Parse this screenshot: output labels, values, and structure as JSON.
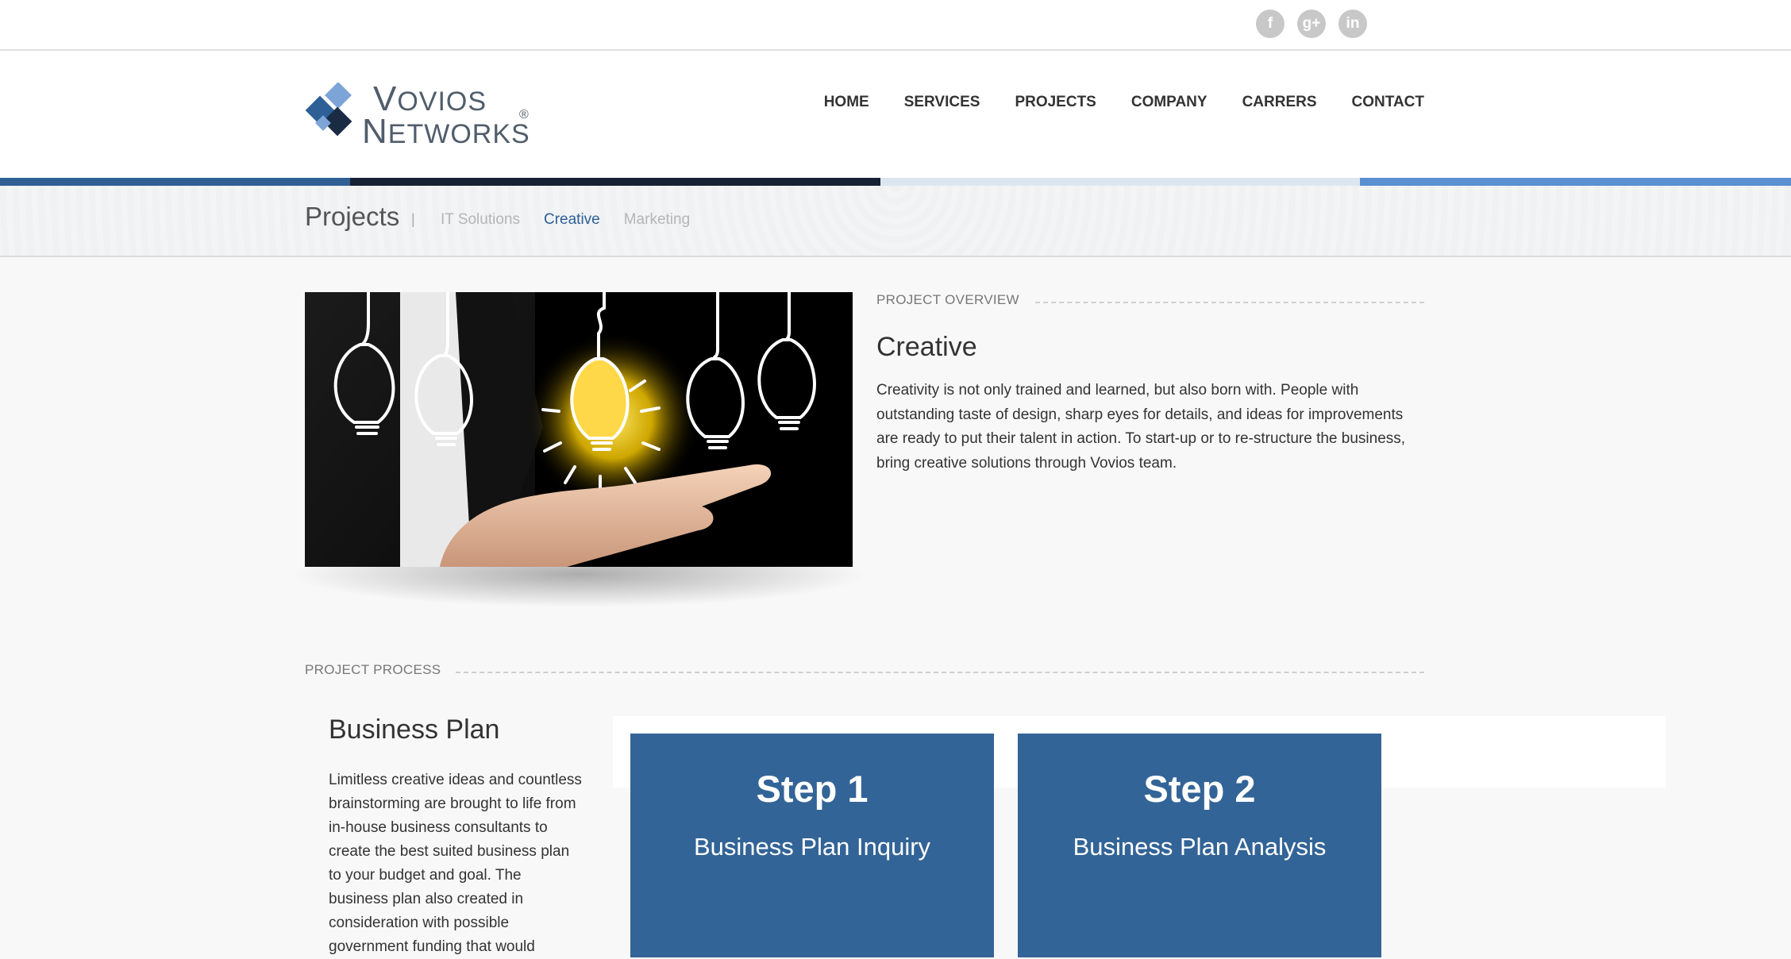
{
  "social": {
    "facebook": "f",
    "googleplus": "g+",
    "linkedin": "in"
  },
  "logo": {
    "line1_initial": "V",
    "line1_rest": "OVIOS",
    "line2_initial": "N",
    "line2_rest": "ETWORKS",
    "reg": "®"
  },
  "nav": {
    "items": [
      "HOME",
      "SERVICES",
      "PROJECTS",
      "COMPANY",
      "CARRERS",
      "CONTACT"
    ]
  },
  "colors": {
    "accent_1": "#2f5f93",
    "accent_2": "#162232",
    "accent_3": "#dce6f1",
    "accent_4": "#5a8fd0",
    "step_card": "#336497",
    "active_link": "#2c5f95"
  },
  "subnav": {
    "title": "Projects",
    "separator": "|",
    "links": [
      "IT Solutions",
      "Creative",
      "Marketing"
    ],
    "active": "Creative"
  },
  "overview": {
    "label": "PROJECT OVERVIEW",
    "title": "Creative",
    "text": "Creativity is not only trained and learned, but also born with. People with outstanding taste of design, sharp eyes for details, and ideas for improvements are ready to put their talent in action. To start-up or to re-structure the business, bring creative solutions through Vovios team."
  },
  "process": {
    "label": "PROJECT PROCESS",
    "title": "Business Plan",
    "text": "Limitless creative ideas and countless brainstorming are brought to life from in-house business consultants to create the best suited business plan to your budget and goal. The business plan also created in consideration with possible government funding that would",
    "steps": [
      {
        "number": "Step 1",
        "name": "Business Plan Inquiry"
      },
      {
        "number": "Step 2",
        "name": "Business Plan Analysis"
      }
    ]
  },
  "icons": {
    "facebook": "facebook-icon",
    "googleplus": "google-plus-icon",
    "linkedin": "linkedin-icon",
    "logo": "vovios-logo-icon",
    "hero": "lightbulb-hand-image"
  }
}
